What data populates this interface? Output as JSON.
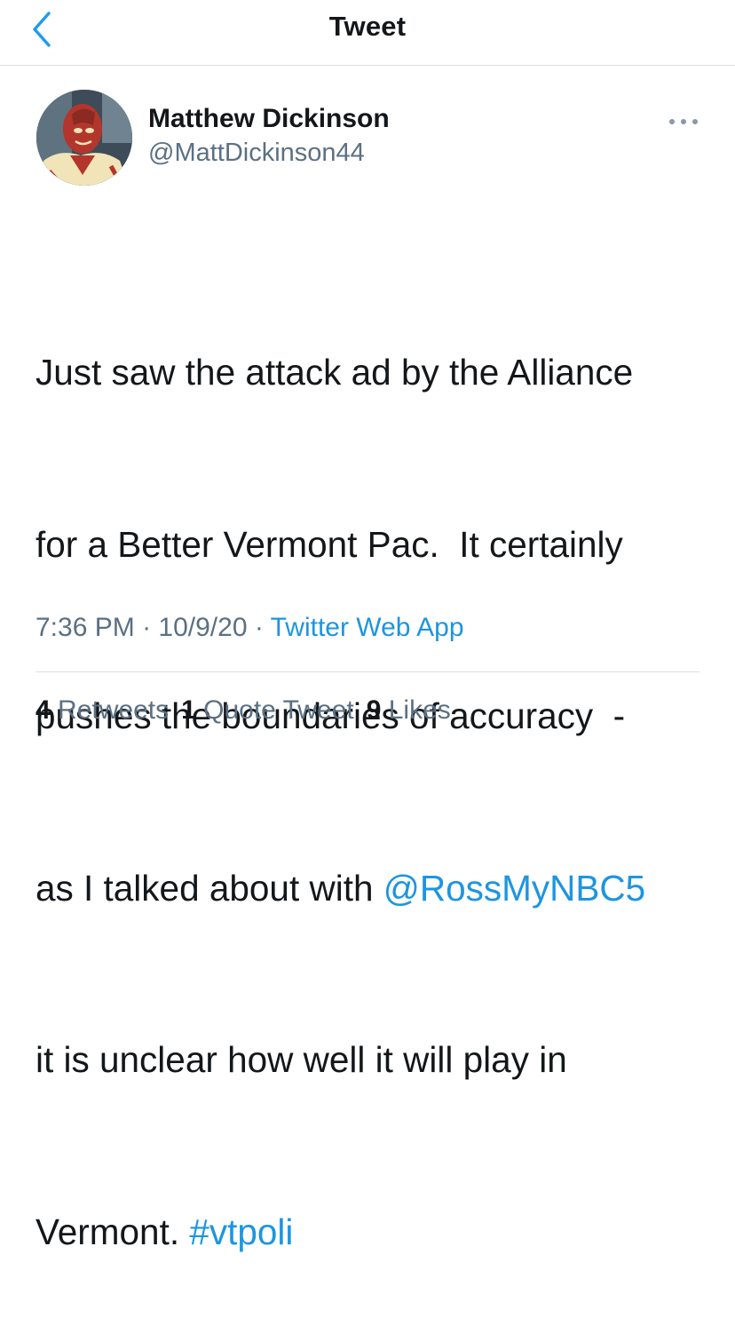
{
  "header": {
    "title": "Tweet",
    "back_icon": "chevron-left-icon",
    "accent_color": "#1d9bf0"
  },
  "author": {
    "name": "Matthew Dickinson",
    "handle": "@MattDickinson44",
    "more_icon": "more-dots-icon"
  },
  "tweet": {
    "lines": [
      {
        "text": "Just saw the attack ad by the Alliance"
      },
      {
        "text": "for a Better Vermont Pac.  It certainly"
      },
      {
        "text": "pushes the boundaries of accuracy  -"
      },
      {
        "pre": "as I talked about with ",
        "mention": "@RossMyNBC5"
      },
      {
        "text": "it is unclear how well it will play in"
      },
      {
        "pre": "Vermont. ",
        "hashtag": "#vtpoli"
      }
    ]
  },
  "meta": {
    "time": "7:36 PM",
    "separator": " · ",
    "date": "10/9/20",
    "source": "Twitter Web App"
  },
  "stats": {
    "retweets_count": "4",
    "retweets_label": "Retweets",
    "quotes_count": "1",
    "quotes_label": "Quote Tweet",
    "likes_count": "9",
    "likes_label": "Likes"
  }
}
